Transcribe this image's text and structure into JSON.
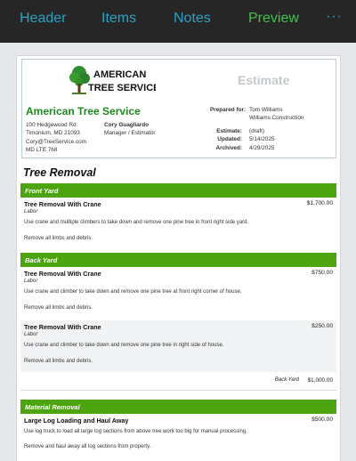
{
  "tabs": [
    {
      "label": "Header"
    },
    {
      "label": "Items"
    },
    {
      "label": "Notes"
    },
    {
      "label": "Preview"
    },
    {
      "label": "···"
    }
  ],
  "colors": {
    "topbar": "#262626",
    "tab": "#2aa3c7",
    "tab_active": "#41c44a",
    "category": "#4ca50f",
    "company": "#1f8a1f"
  },
  "logo": {
    "line1": "AMERICAN",
    "line2": "TREE SERVICE",
    "icon": "tree-logo"
  },
  "doc": {
    "label": "Estimate"
  },
  "company": {
    "name": "American Tree Service",
    "address1": "100 Hedgewood Rd",
    "address2": "Timonium, MD 21093",
    "email": "Cory@TreeService.com",
    "license": "MD LTE 768",
    "contact_name": "Cory Guagliardo",
    "contact_title": "Manager / Estimator"
  },
  "prepared": {
    "label": "Prepared for:",
    "name": "Tom Williams",
    "company": "Williams Construction"
  },
  "meta": {
    "estimate_label": "Estimate:",
    "estimate_value": "(draft)",
    "updated_label": "Updated:",
    "updated_value": "5/14/2025",
    "archived_label": "Archived:",
    "archived_value": "4/29/2025"
  },
  "section": {
    "title": "Tree Removal"
  },
  "categories": {
    "front": "Front Yard",
    "back": "Back Yard",
    "material": "Material Removal"
  },
  "items": {
    "front1": {
      "name": "Tree Removal With Crane",
      "type": "Labor",
      "price": "$1,700.00",
      "desc1": "Use crane and multiple climbers to take down and remove one pine tree in front right side yard.",
      "desc2": "Remove all limbs and debris."
    },
    "back1": {
      "name": "Tree Removal With Crane",
      "type": "Labor",
      "price": "$750.00",
      "desc1": "Use crane and climber to take down and remove one pine tree at front right corner of house.",
      "desc2": "Remove all limbs and debris."
    },
    "back2": {
      "name": "Tree Removal With Crane",
      "type": "Labor",
      "price": "$250.00",
      "desc1": "Use crane and climber to take down and remove one pine tree in right side of house.",
      "desc2": "Remove all limbs and debris."
    },
    "mat1": {
      "name": "Large Log Loading and Haul Away",
      "price": "$500.00",
      "desc1": "Use log truck to load all large log sections from above tree work too big for manual processing.",
      "desc2": "Remove and haul away all log sections from property."
    }
  },
  "subtotal": {
    "label": "Back Yard",
    "value": "$1,000.00"
  }
}
